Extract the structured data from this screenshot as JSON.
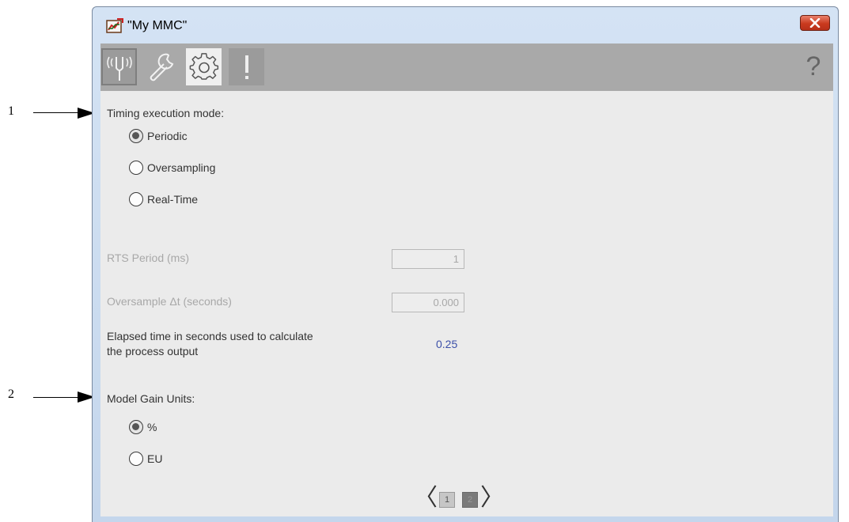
{
  "callouts": [
    "1",
    "2"
  ],
  "window": {
    "title": "\"My MMC\"",
    "close_icon": "close-x-icon"
  },
  "toolbar": {
    "tabs": [
      {
        "name": "diagnostics",
        "icon": "tuning-fork-icon",
        "selected": false
      },
      {
        "name": "maintenance",
        "icon": "wrench-icon",
        "selected": false
      },
      {
        "name": "configuration",
        "icon": "gear-icon",
        "selected": true
      },
      {
        "name": "alarms",
        "icon": "exclamation-icon",
        "selected": false
      }
    ],
    "help_label": "?"
  },
  "timing": {
    "heading": "Timing execution mode:",
    "options": [
      "Periodic",
      "Oversampling",
      "Real-Time"
    ],
    "selected": "Periodic"
  },
  "rts_period": {
    "label": "RTS Period (ms)",
    "value": "1"
  },
  "oversample": {
    "label": "Oversample Δt  (seconds)",
    "value": "0.000"
  },
  "elapsed": {
    "label_line1": "Elapsed time in seconds used to calculate",
    "label_line2": "the process output",
    "value": "0.25"
  },
  "gain_units": {
    "heading": "Model Gain Units:",
    "options": [
      "%",
      "EU"
    ],
    "selected": "%"
  },
  "pager": {
    "prev": "〈",
    "next": "〉",
    "pages": [
      "1",
      "2"
    ],
    "current": "2"
  },
  "colors": {
    "accent_blue": "#3b4fa8",
    "close_red": "#c93a1e",
    "toolbar_gray": "#a9a9a9"
  }
}
